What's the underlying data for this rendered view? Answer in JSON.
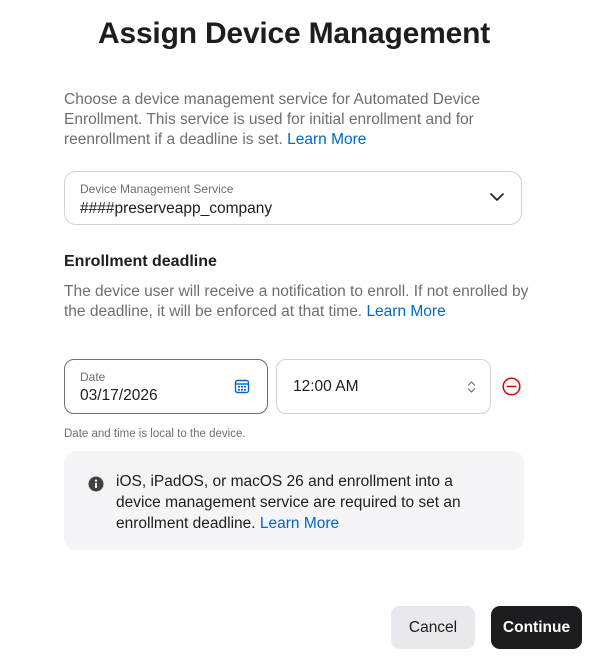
{
  "dialog": {
    "title": "Assign Device Management",
    "intro_text": "Choose a device management service for Automated Device Enrollment. This service is used for initial enrollment and for reenrollment if a deadline is set. ",
    "intro_link": "Learn More"
  },
  "service_select": {
    "label": "Device Management Service",
    "value": "####preserveapp_company",
    "icon": "chevron-down-icon"
  },
  "deadline": {
    "heading": "Enrollment deadline",
    "description": "The device user will receive a notification to enroll. If not enrolled by the deadline, it will be enforced at that time. ",
    "link": "Learn More",
    "date_label": "Date",
    "date_value": "03/17/2026",
    "time_value": "12:00 AM",
    "hint": "Date and time is local to the device."
  },
  "info": {
    "text": "iOS, iPadOS, or macOS 26 and enrollment into a device management service are required to set an enrollment deadline. ",
    "link": "Learn More"
  },
  "buttons": {
    "cancel": "Cancel",
    "continue": "Continue"
  },
  "colors": {
    "link": "#0066cc",
    "remove": "#e30000",
    "primary_button": "#1d1d1f",
    "secondary_button": "#e8e8ed",
    "info_background": "#f5f5f7"
  }
}
